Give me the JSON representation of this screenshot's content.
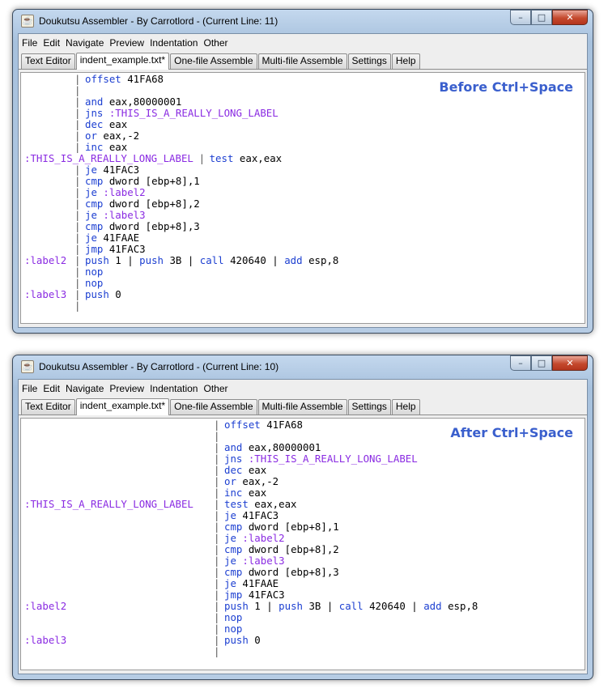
{
  "windows": [
    {
      "title": "Doukutsu Assembler - By Carrotlord - (Current Line: 11)",
      "caption": "Before Ctrl+Space",
      "lines": [
        {
          "label": "",
          "ops": [
            {
              "k": "kw",
              "t": "offset"
            },
            {
              "k": "pl",
              "t": " 41FA68"
            }
          ]
        },
        {
          "label": "",
          "ops": []
        },
        {
          "label": "",
          "ops": [
            {
              "k": "kw",
              "t": "and"
            },
            {
              "k": "pl",
              "t": " eax,80000001"
            }
          ]
        },
        {
          "label": "",
          "ops": [
            {
              "k": "kw",
              "t": "jns"
            },
            {
              "k": "lab",
              "t": " :THIS_IS_A_REALLY_LONG_LABEL"
            }
          ]
        },
        {
          "label": "",
          "ops": [
            {
              "k": "kw",
              "t": "dec"
            },
            {
              "k": "pl",
              "t": " eax"
            }
          ]
        },
        {
          "label": "",
          "ops": [
            {
              "k": "kw",
              "t": "or"
            },
            {
              "k": "pl",
              "t": " eax,-2"
            }
          ]
        },
        {
          "label": "",
          "ops": [
            {
              "k": "kw",
              "t": "inc"
            },
            {
              "k": "pl",
              "t": " eax"
            }
          ]
        },
        {
          "label": ":THIS_IS_A_REALLY_LONG_LABEL",
          "ops": [
            {
              "k": "kw",
              "t": "test"
            },
            {
              "k": "pl",
              "t": " eax,eax"
            }
          ]
        },
        {
          "label": "",
          "ops": [
            {
              "k": "kw",
              "t": "je"
            },
            {
              "k": "pl",
              "t": " 41FAC3"
            }
          ]
        },
        {
          "label": "",
          "ops": [
            {
              "k": "kw",
              "t": "cmp"
            },
            {
              "k": "pl",
              "t": " dword [ebp+8],1"
            }
          ]
        },
        {
          "label": "",
          "ops": [
            {
              "k": "kw",
              "t": "je"
            },
            {
              "k": "lab",
              "t": " :label2"
            }
          ]
        },
        {
          "label": "",
          "ops": [
            {
              "k": "kw",
              "t": "cmp"
            },
            {
              "k": "pl",
              "t": " dword [ebp+8],2"
            }
          ]
        },
        {
          "label": "",
          "ops": [
            {
              "k": "kw",
              "t": "je"
            },
            {
              "k": "lab",
              "t": " :label3"
            }
          ]
        },
        {
          "label": "",
          "ops": [
            {
              "k": "kw",
              "t": "cmp"
            },
            {
              "k": "pl",
              "t": " dword [ebp+8],3"
            }
          ]
        },
        {
          "label": "",
          "ops": [
            {
              "k": "kw",
              "t": "je"
            },
            {
              "k": "pl",
              "t": " 41FAAE"
            }
          ]
        },
        {
          "label": "",
          "ops": [
            {
              "k": "kw",
              "t": "jmp"
            },
            {
              "k": "pl",
              "t": " 41FAC3"
            }
          ]
        },
        {
          "label": ":label2",
          "ops": [
            {
              "k": "kw",
              "t": "push"
            },
            {
              "k": "pl",
              "t": " 1 | "
            },
            {
              "k": "kw",
              "t": "push"
            },
            {
              "k": "pl",
              "t": " 3B | "
            },
            {
              "k": "kw",
              "t": "call"
            },
            {
              "k": "pl",
              "t": " 420640 | "
            },
            {
              "k": "kw",
              "t": "add"
            },
            {
              "k": "pl",
              "t": " esp,8"
            }
          ]
        },
        {
          "label": "",
          "ops": [
            {
              "k": "kw",
              "t": "nop"
            }
          ]
        },
        {
          "label": "",
          "ops": [
            {
              "k": "kw",
              "t": "nop"
            }
          ]
        },
        {
          "label": ":label3",
          "ops": [
            {
              "k": "kw",
              "t": "push"
            },
            {
              "k": "pl",
              "t": " 0"
            }
          ]
        },
        {
          "label": "",
          "ops": []
        }
      ]
    },
    {
      "title": "Doukutsu Assembler - By Carrotlord - (Current Line: 10)",
      "caption": "After Ctrl+Space",
      "lines": [
        {
          "label": "",
          "ops": [
            {
              "k": "kw",
              "t": "offset"
            },
            {
              "k": "pl",
              "t": " 41FA68"
            }
          ]
        },
        {
          "label": "",
          "ops": []
        },
        {
          "label": "",
          "ops": [
            {
              "k": "kw",
              "t": "and"
            },
            {
              "k": "pl",
              "t": " eax,80000001"
            }
          ]
        },
        {
          "label": "",
          "ops": [
            {
              "k": "kw",
              "t": "jns"
            },
            {
              "k": "lab",
              "t": " :THIS_IS_A_REALLY_LONG_LABEL"
            }
          ]
        },
        {
          "label": "",
          "ops": [
            {
              "k": "kw",
              "t": "dec"
            },
            {
              "k": "pl",
              "t": " eax"
            }
          ]
        },
        {
          "label": "",
          "ops": [
            {
              "k": "kw",
              "t": "or"
            },
            {
              "k": "pl",
              "t": " eax,-2"
            }
          ]
        },
        {
          "label": "",
          "ops": [
            {
              "k": "kw",
              "t": "inc"
            },
            {
              "k": "pl",
              "t": " eax"
            }
          ]
        },
        {
          "label": ":THIS_IS_A_REALLY_LONG_LABEL",
          "ops": [
            {
              "k": "kw",
              "t": "test"
            },
            {
              "k": "pl",
              "t": " eax,eax"
            }
          ]
        },
        {
          "label": "",
          "ops": [
            {
              "k": "kw",
              "t": "je"
            },
            {
              "k": "pl",
              "t": " 41FAC3"
            }
          ]
        },
        {
          "label": "",
          "ops": [
            {
              "k": "kw",
              "t": "cmp"
            },
            {
              "k": "pl",
              "t": " dword [ebp+8],1"
            }
          ]
        },
        {
          "label": "",
          "ops": [
            {
              "k": "kw",
              "t": "je"
            },
            {
              "k": "lab",
              "t": " :label2"
            }
          ]
        },
        {
          "label": "",
          "ops": [
            {
              "k": "kw",
              "t": "cmp"
            },
            {
              "k": "pl",
              "t": " dword [ebp+8],2"
            }
          ]
        },
        {
          "label": "",
          "ops": [
            {
              "k": "kw",
              "t": "je"
            },
            {
              "k": "lab",
              "t": " :label3"
            }
          ]
        },
        {
          "label": "",
          "ops": [
            {
              "k": "kw",
              "t": "cmp"
            },
            {
              "k": "pl",
              "t": " dword [ebp+8],3"
            }
          ]
        },
        {
          "label": "",
          "ops": [
            {
              "k": "kw",
              "t": "je"
            },
            {
              "k": "pl",
              "t": " 41FAAE"
            }
          ]
        },
        {
          "label": "",
          "ops": [
            {
              "k": "kw",
              "t": "jmp"
            },
            {
              "k": "pl",
              "t": " 41FAC3"
            }
          ]
        },
        {
          "label": ":label2",
          "ops": [
            {
              "k": "kw",
              "t": "push"
            },
            {
              "k": "pl",
              "t": " 1 | "
            },
            {
              "k": "kw",
              "t": "push"
            },
            {
              "k": "pl",
              "t": " 3B | "
            },
            {
              "k": "kw",
              "t": "call"
            },
            {
              "k": "pl",
              "t": " 420640 | "
            },
            {
              "k": "kw",
              "t": "add"
            },
            {
              "k": "pl",
              "t": " esp,8"
            }
          ]
        },
        {
          "label": "",
          "ops": [
            {
              "k": "kw",
              "t": "nop"
            }
          ]
        },
        {
          "label": "",
          "ops": [
            {
              "k": "kw",
              "t": "nop"
            }
          ]
        },
        {
          "label": ":label3",
          "ops": [
            {
              "k": "kw",
              "t": "push"
            },
            {
              "k": "pl",
              "t": " 0"
            }
          ]
        },
        {
          "label": "",
          "ops": []
        }
      ]
    }
  ],
  "menu": [
    "File",
    "Edit",
    "Navigate",
    "Preview",
    "Indentation",
    "Other"
  ],
  "tabs": [
    {
      "label": "Text Editor",
      "active": false
    },
    {
      "label": "indent_example.txt*",
      "active": true
    },
    {
      "label": "One-file Assemble",
      "active": false
    },
    {
      "label": "Multi-file Assemble",
      "active": false
    },
    {
      "label": "Settings",
      "active": false
    },
    {
      "label": "Help",
      "active": false
    }
  ],
  "window_buttons": {
    "minimize": "–",
    "maximize": "□",
    "close": "✕"
  },
  "app_icon_glyph": "☕",
  "colors": {
    "keyword": "#1c3fd1",
    "label": "#8a2be2",
    "caption": "#3a5fcd"
  }
}
